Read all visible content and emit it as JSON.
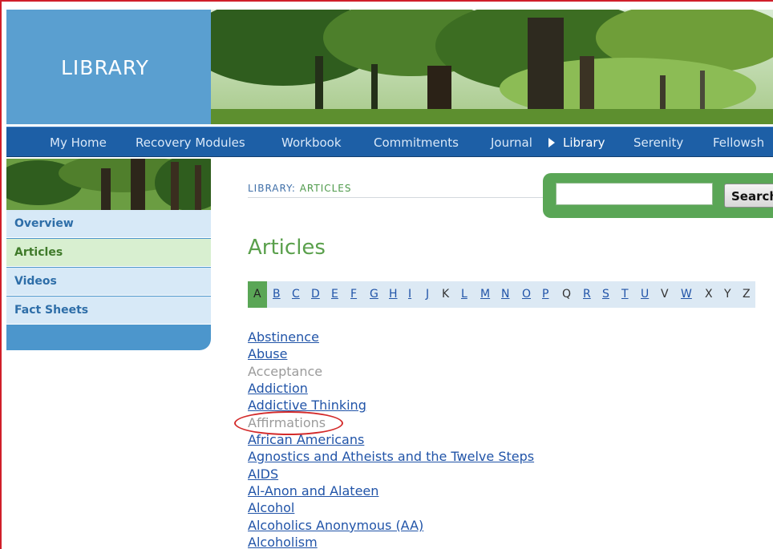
{
  "header": {
    "title": "LIBRARY"
  },
  "nav": {
    "items": [
      {
        "label": "My Home"
      },
      {
        "label": "Recovery Modules"
      },
      {
        "label": "Workbook"
      },
      {
        "label": "Commitments"
      },
      {
        "label": "Journal"
      },
      {
        "label": "Library",
        "active": true
      },
      {
        "label": "Serenity"
      },
      {
        "label": "Fellowsh"
      }
    ]
  },
  "sidebar": {
    "items": [
      {
        "label": "Overview"
      },
      {
        "label": "Articles",
        "active": true
      },
      {
        "label": "Videos"
      },
      {
        "label": "Fact Sheets"
      }
    ]
  },
  "breadcrumb": {
    "section": "LIBRARY: ",
    "current": "ARTICLES"
  },
  "search": {
    "value": "",
    "button_label": "Search"
  },
  "page": {
    "title": "Articles"
  },
  "alphabet": {
    "selected": "A",
    "letters": [
      {
        "letter": "B",
        "link": true
      },
      {
        "letter": "C",
        "link": true
      },
      {
        "letter": "D",
        "link": true
      },
      {
        "letter": "E",
        "link": true
      },
      {
        "letter": "F",
        "link": true
      },
      {
        "letter": "G",
        "link": true
      },
      {
        "letter": "H",
        "link": true
      },
      {
        "letter": "I",
        "link": true
      },
      {
        "letter": "J",
        "link": true
      },
      {
        "letter": "K",
        "link": false
      },
      {
        "letter": "L",
        "link": true
      },
      {
        "letter": "M",
        "link": true
      },
      {
        "letter": "N",
        "link": true
      },
      {
        "letter": "O",
        "link": true
      },
      {
        "letter": "P",
        "link": true
      },
      {
        "letter": "Q",
        "link": false
      },
      {
        "letter": "R",
        "link": true
      },
      {
        "letter": "S",
        "link": true
      },
      {
        "letter": "T",
        "link": true
      },
      {
        "letter": "U",
        "link": true
      },
      {
        "letter": "V",
        "link": false
      },
      {
        "letter": "W",
        "link": true
      },
      {
        "letter": "X",
        "link": false
      },
      {
        "letter": "Y",
        "link": false
      },
      {
        "letter": "Z",
        "link": false
      }
    ]
  },
  "articles": [
    {
      "title": "Abstinence",
      "disabled": false
    },
    {
      "title": "Abuse",
      "disabled": false
    },
    {
      "title": "Acceptance",
      "disabled": true
    },
    {
      "title": "Addiction",
      "disabled": false
    },
    {
      "title": "Addictive Thinking",
      "disabled": false
    },
    {
      "title": "Affirmations",
      "disabled": true
    },
    {
      "title": "African Americans",
      "disabled": false
    },
    {
      "title": "Agnostics and Atheists and the Twelve Steps",
      "disabled": false
    },
    {
      "title": "AIDS",
      "disabled": false
    },
    {
      "title": "Al-Anon and Alateen",
      "disabled": false
    },
    {
      "title": "Alcohol",
      "disabled": false
    },
    {
      "title": "Alcoholics Anonymous (AA)",
      "disabled": false
    },
    {
      "title": "Alcoholism",
      "disabled": false
    }
  ],
  "colors": {
    "accent_green": "#5aa656",
    "nav_blue": "#1d5fa6",
    "link_blue": "#2154a8",
    "annotation_red": "#d32a2a"
  }
}
